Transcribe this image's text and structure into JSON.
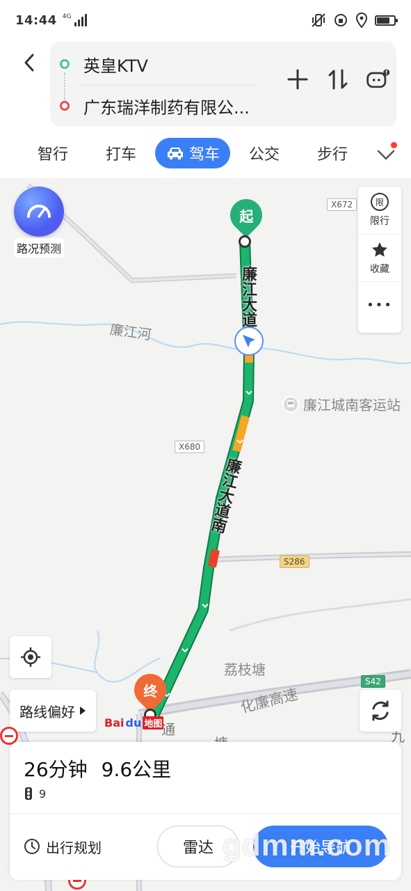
{
  "status_bar": {
    "time": "14:44",
    "network": "4G"
  },
  "header": {
    "start_place": "英皇KTV",
    "end_place": "广东瑞洋制药有限公...",
    "icons": [
      "back-icon",
      "add-waypoint-icon",
      "swap-icon",
      "voice-assistant-icon"
    ]
  },
  "mode_tabs": {
    "smart": "智行",
    "taxi": "打车",
    "drive": "驾车",
    "bus": "公交",
    "walk": "步行"
  },
  "map": {
    "traffic_predict_label": "路况预测",
    "limit_label": "限行",
    "limit_icon_char": "限",
    "favorite_label": "收藏",
    "more_label": "•••",
    "start_pin": "起",
    "end_pin": "终",
    "road_main": "廉江大道",
    "road_south": "廉江大道南",
    "river": "廉江河",
    "poi_station": "廉江城南客运站",
    "village": "荔枝塘",
    "expressway": "化廉高速",
    "badge_x672": "X672",
    "badge_x680": "X680",
    "badge_s286": "S286",
    "badge_s42": "S42",
    "partial_label_1": "九",
    "partial_label_2": "塘",
    "partial_label_3": "通",
    "route_preference": "路线偏好",
    "baidu_logo": {
      "b1": "Bai",
      "b2": "du",
      "b3": "地图"
    },
    "colors": {
      "route_green": "#1db46c",
      "route_yellow": "#f5a623",
      "route_red": "#e8412c",
      "accent": "#3b7ff6"
    }
  },
  "bottom_card": {
    "duration": "26分钟",
    "distance": "9.6公里",
    "traffic_lights": "9",
    "plan_label": "出行规划",
    "radar_label": "雷达",
    "start_nav_label": "开始导航"
  },
  "watermark": "gdmm.com"
}
